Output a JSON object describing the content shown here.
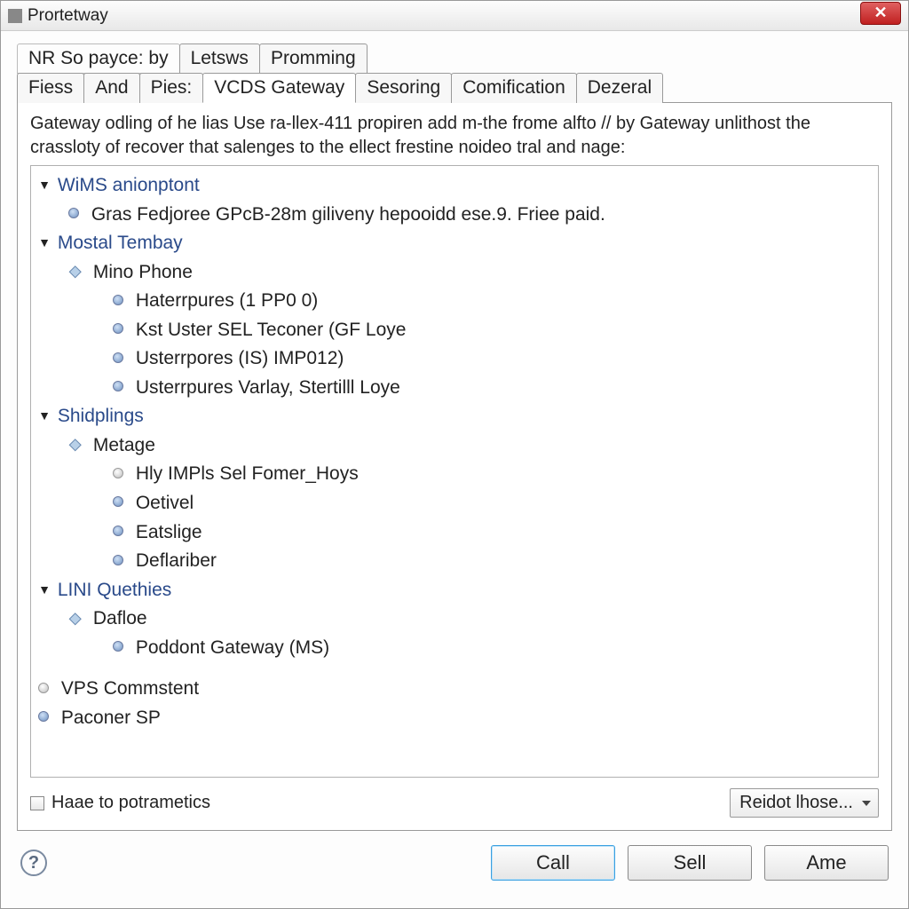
{
  "window": {
    "title": "Prortetway"
  },
  "tabs_row1": [
    {
      "label": "NR So payce: by"
    },
    {
      "label": "Letsws"
    },
    {
      "label": "Promming"
    }
  ],
  "tabs_row2": [
    {
      "label": "Fiess"
    },
    {
      "label": "And"
    },
    {
      "label": "Pies:"
    },
    {
      "label": "VCDS Gateway",
      "active": true
    },
    {
      "label": "Sesoring"
    },
    {
      "label": "Comification"
    },
    {
      "label": "Dezeral"
    }
  ],
  "description": "Gateway odling of he lias Use ra-llex-411 propiren add m-the frome alfto // by Gateway unlithost the crassloty of recover that salenges to the ellect frestine noideo tral and nage:",
  "tree": {
    "groups": [
      {
        "title": "WiMS anionptont",
        "items": [
          {
            "label": "Gras Fedjoree GPcB-28m giliveny hepooidd ese.9. Friee paid."
          }
        ]
      },
      {
        "title": "Mostal Tembay",
        "subgroup": "Mino Phone",
        "items": [
          {
            "label": "Haterrpures (1 PP0 0)"
          },
          {
            "label": "Kst Uster SEL Teconer (GF Loye"
          },
          {
            "label": "Usterrpores (IS) IMP012)"
          },
          {
            "label": "Usterrpures Varlay, Stertilll Loye"
          }
        ]
      },
      {
        "title": "Shidplings",
        "subgroup": "Metage",
        "items": [
          {
            "label": "Hly IMPls Sel Fomer_Hoys",
            "hollow": true
          },
          {
            "label": "Oetivel"
          },
          {
            "label": "Eatslige"
          },
          {
            "label": "Deflariber"
          }
        ]
      },
      {
        "title": "LINI Quethies",
        "subgroup": "Dafloe",
        "items": [
          {
            "label": "Poddont Gateway (MS)"
          }
        ]
      }
    ],
    "footer_items": [
      {
        "label": "VPS Commstent",
        "hollow": true
      },
      {
        "label": "Paconer SP"
      }
    ]
  },
  "checkbox_label": "Haae to potrametics",
  "combo_label": "Reidot lhose...",
  "buttons": {
    "primary": "Call",
    "secondary": "Sell",
    "tertiary": "Ame"
  }
}
